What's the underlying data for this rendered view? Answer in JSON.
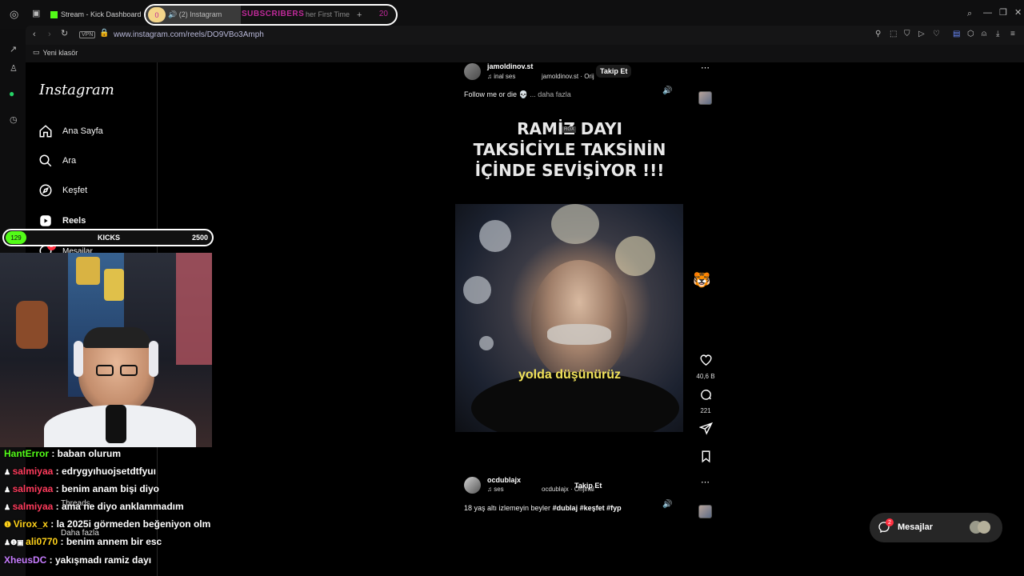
{
  "browser": {
    "tab_kick": "Stream - Kick Dashboard",
    "tab_instagram": "(2) Instagram",
    "tab_other": "her First Time",
    "subs_left": "0",
    "subs_label": "SUBSCRIBERS",
    "subs_right": "20",
    "new_tab": "+",
    "vpn": "VPN",
    "url": "www.instagram.com/reels/DO9VBo3Amph",
    "bookmark_folder": "Yeni klasör"
  },
  "instagram": {
    "logo": "Instagram",
    "nav": [
      {
        "label": "Ana Sayfa",
        "icon": "home-icon"
      },
      {
        "label": "Ara",
        "icon": "search-icon"
      },
      {
        "label": "Keşfet",
        "icon": "compass-icon"
      },
      {
        "label": "Reels",
        "icon": "reels-icon"
      },
      {
        "label": "Mesajlar",
        "icon": "messenger-icon",
        "badge": "2"
      }
    ],
    "threads_label": "Threads",
    "more_label": "Daha fazla",
    "reel1": {
      "username": "jamoldinov.st",
      "audio_label": "inal ses",
      "audio_owner": "jamoldinov.st · Orij",
      "follow": "Takip Et",
      "caption": "Follow me or die 💀",
      "more": "... daha fazla",
      "title_lines": [
        "RAMİZ DAYI",
        "TAKSİCİYLE TAKSİNİN",
        "İÇİNDE SEVİŞİYOR !!!"
      ],
      "watermark": "RGX",
      "subtitle": "yolda düşünürüz",
      "likes": "40,6 B",
      "comments": "221"
    },
    "reel2": {
      "username": "ocdublajx",
      "audio_label": "ses",
      "audio_owner": "ocdublajx · Orijinal",
      "follow": "Takip Et",
      "caption_prefix": "18 yaş altı izlemeyin beyler ",
      "hashtags": "#dublaj #keşfet #fyp"
    },
    "messages_pill": {
      "label": "Mesajlar",
      "badge": "2"
    }
  },
  "stream": {
    "kicks_left": "129",
    "kicks_label": "KICKS",
    "kicks_value": "2500",
    "chat": [
      {
        "user": "HantError",
        "color": "#53fc18",
        "text": " : baban olurum"
      },
      {
        "user": "salmiyaa",
        "color": "#ff3b5c",
        "text": " : edrygyıhuojsetdtfyuı"
      },
      {
        "user": "salmiyaa",
        "color": "#ff3b5c",
        "text": " : benim anam bişi diyo"
      },
      {
        "user": "salmiyaa",
        "color": "#ff3b5c",
        "text": " : ama ne diyo anklammadım"
      },
      {
        "user": "Virox_x",
        "color": "#ffd21a",
        "text": " : la 2025i görmeden beğeniyon olm"
      },
      {
        "user": "ali0770",
        "color": "#ffd21a",
        "text": " : benim annem bir esc"
      },
      {
        "user": "XheusDC",
        "color": "#c77dff",
        "text": " : yakışmadı ramiz dayı"
      }
    ]
  },
  "colors": {
    "kick_green": "#53fc18",
    "ig_bg": "#000000",
    "subtitle_yellow": "#f2e35a"
  }
}
